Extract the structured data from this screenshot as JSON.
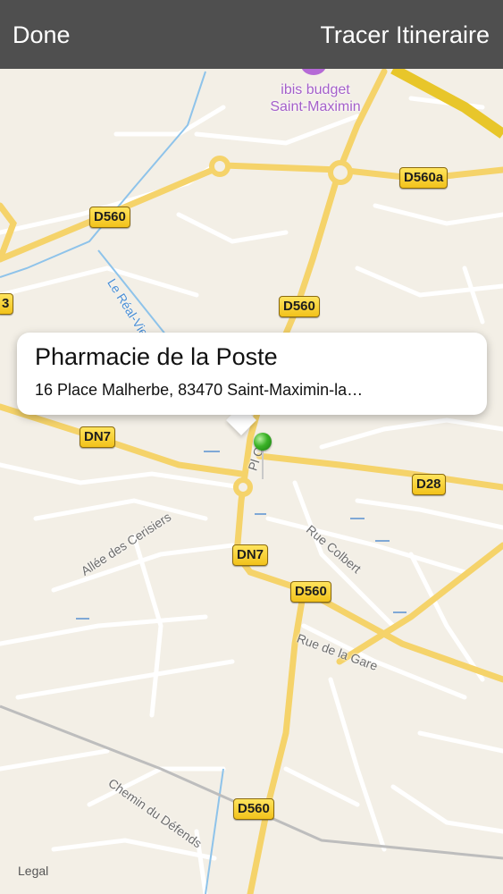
{
  "navbar": {
    "done_label": "Done",
    "route_label": "Tracer Itineraire"
  },
  "poi": {
    "name": "ibis budget\nSaint-Maximin",
    "icon": "hotel-pin-icon",
    "color": "#b56ad6"
  },
  "callout": {
    "title": "Pharmacie de la Poste",
    "address": "16 Place Malherbe, 83470 Saint-Maximin-la…"
  },
  "pin": {
    "color": "#3ab226",
    "icon": "map-pin-icon"
  },
  "road_labels": [
    "D560a",
    "D560",
    "3",
    "D560",
    "DN7",
    "D28",
    "DN7",
    "D560",
    "D560"
  ],
  "street_labels": [
    "Allée des Cerisiers",
    "Rue Colbert",
    "Rue de la Gare",
    "Chemin du Défends",
    "Pl Ca"
  ],
  "river_label": "Le Réal-Vie",
  "legal_label": "Legal",
  "colors": {
    "map_bg": "#f3efe6",
    "road_yellow": "#f5d36a",
    "highway": "#e8c62a",
    "water": "#8ec3ea"
  }
}
